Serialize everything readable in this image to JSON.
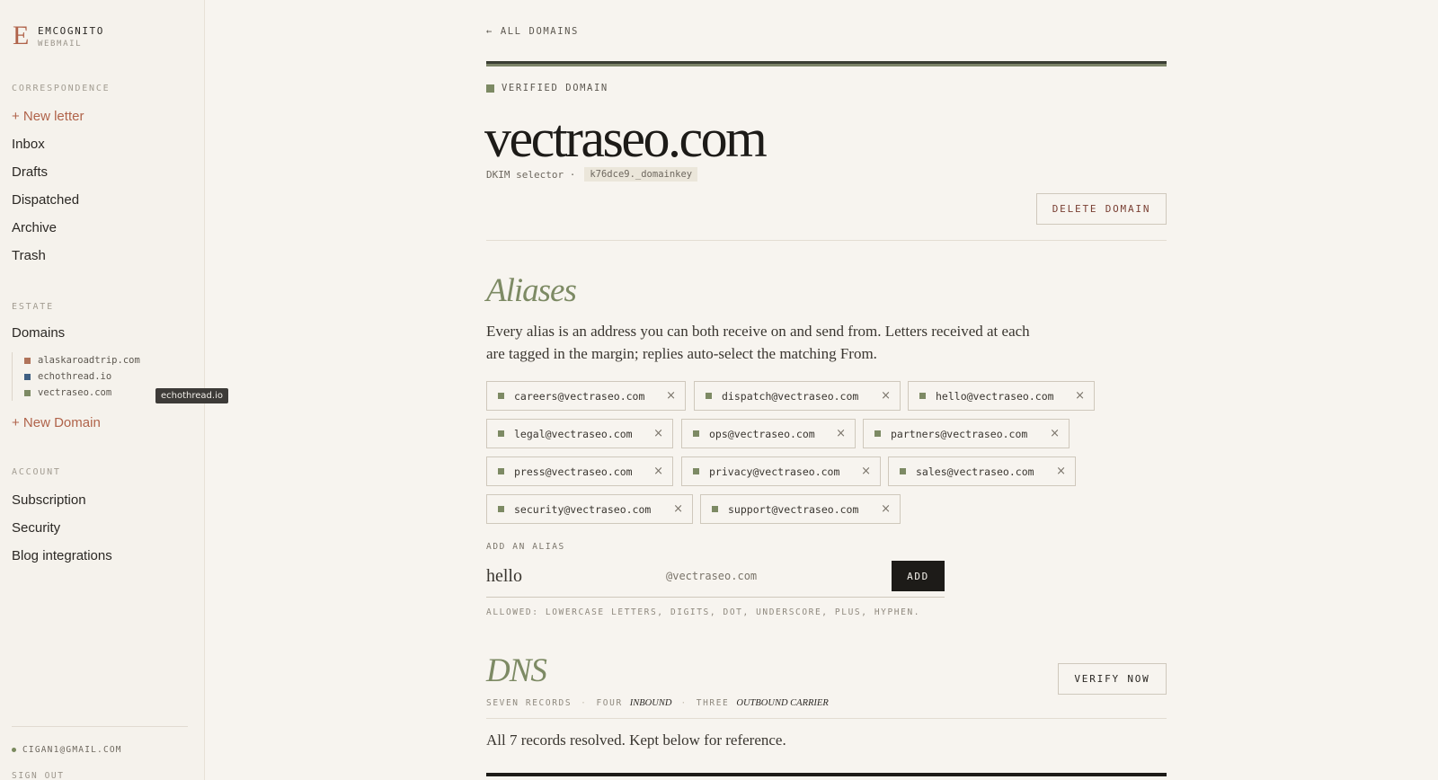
{
  "brand": {
    "mark": "E",
    "name": "EMCOGNITO",
    "sub": "WEBMAIL"
  },
  "sidebar": {
    "correspondence_label": "CORRESPONDENCE",
    "new_letter": "+ New letter",
    "items": [
      "Inbox",
      "Drafts",
      "Dispatched",
      "Archive",
      "Trash"
    ],
    "estate_label": "ESTATE",
    "domains_label": "Domains",
    "domains": [
      {
        "name": "alaskaroadtrip.com",
        "color": "#b0735a"
      },
      {
        "name": "echothread.io",
        "color": "#3f5f82"
      },
      {
        "name": "vectraseo.com",
        "color": "#7d8a64"
      }
    ],
    "tooltip": "echothread.io",
    "new_domain": "+ New Domain",
    "account_label": "ACCOUNT",
    "account_items": [
      "Subscription",
      "Security",
      "Blog integrations"
    ],
    "email": "CIGAN1@GMAIL.COM",
    "sign_out": "SIGN OUT"
  },
  "main": {
    "back": "← ALL DOMAINS",
    "verified": "VERIFIED DOMAIN",
    "domain": "vectraseo.com",
    "dkim_label": "DKIM selector ·",
    "dkim_value": "k76dce9._domainkey",
    "delete_button": "DELETE DOMAIN",
    "aliases_heading": "Aliases",
    "aliases_intro": "Every alias is an address you can both receive on and send from. Letters received at each are tagged in the margin; replies auto-select the matching From.",
    "aliases": [
      "careers@vectraseo.com",
      "dispatch@vectraseo.com",
      "hello@vectraseo.com",
      "legal@vectraseo.com",
      "ops@vectraseo.com",
      "partners@vectraseo.com",
      "press@vectraseo.com",
      "privacy@vectraseo.com",
      "sales@vectraseo.com",
      "security@vectraseo.com",
      "support@vectraseo.com"
    ],
    "remove_glyph": "×",
    "add_label": "ADD AN ALIAS",
    "add_value": "hello",
    "add_suffix": "@vectraseo.com",
    "add_button": "ADD",
    "allowed": "ALLOWED: LOWERCASE LETTERS, DIGITS, DOT, UNDERSCORE, PLUS, HYPHEN.",
    "dns_heading": "DNS",
    "verify_button": "VERIFY NOW",
    "dns_records": "SEVEN RECORDS",
    "dns_four": "FOUR",
    "dns_inbound": "INBOUND",
    "dns_three": "THREE",
    "dns_outbound": "OUTBOUND CARRIER",
    "dns_separator": "·",
    "resolved": "All 7 records resolved. Kept below for reference."
  }
}
